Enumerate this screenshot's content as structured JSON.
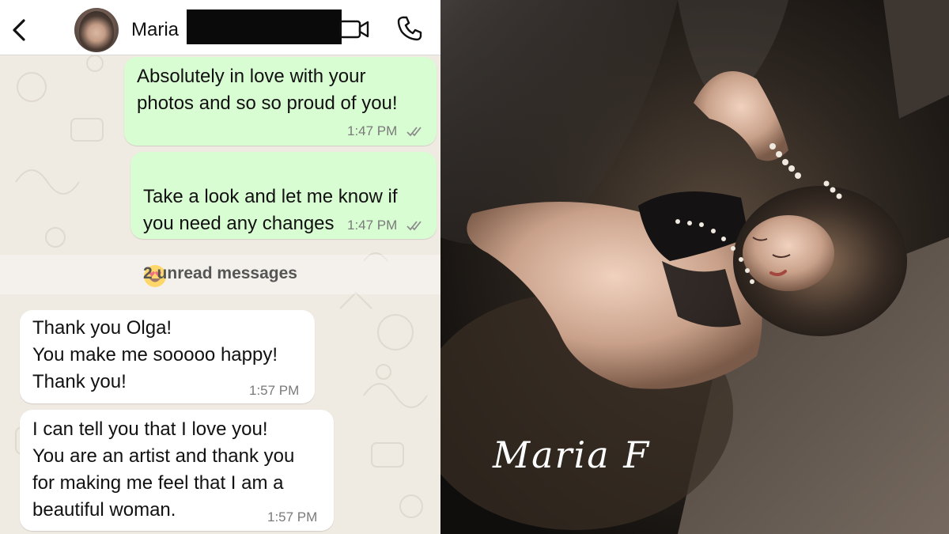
{
  "chat": {
    "contact_name": "Maria",
    "icons": {
      "back": "chevron-left-icon",
      "avatar": "contact-avatar",
      "video": "video-call-icon",
      "call": "phone-icon",
      "read_receipt": "double-check-icon",
      "emoji": "heart-eyes-emoji"
    },
    "messages": [
      {
        "direction": "outgoing",
        "text": "Absolutely in love with your\nphotos and so so proud of you!",
        "time": "1:47 PM",
        "read": true
      },
      {
        "direction": "outgoing",
        "text": "Take a look and let me know if\nyou need any changes",
        "emoji": "😍",
        "time": "1:47 PM",
        "read": true
      },
      {
        "direction": "incoming",
        "text": "Thank you Olga!\nYou make me sooooo happy!\nThank you!",
        "time": "1:57 PM"
      },
      {
        "direction": "incoming",
        "text": "I can tell you that I love you!\nYou are an artist and thank you\nfor making me feel that I am a\nbeautiful woman.",
        "time": "1:57 PM"
      }
    ],
    "unread_label": "2 unread messages",
    "colors": {
      "background": "#efeae2",
      "outgoing_bubble": "#d9fdd3",
      "incoming_bubble": "#ffffff",
      "read_tick": "#8c8c8c"
    }
  },
  "photo": {
    "signature": "Maria F"
  }
}
